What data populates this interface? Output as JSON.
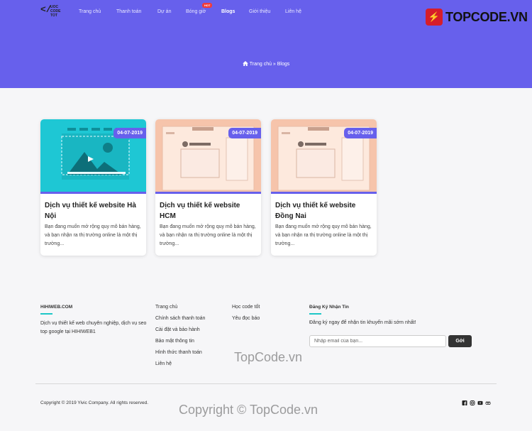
{
  "header": {
    "logo_text_lines": [
      "UOC",
      "CODE",
      "TOT"
    ],
    "nav": [
      {
        "label": "Trang chủ"
      },
      {
        "label": "Thanh toán"
      },
      {
        "label": "Dự án"
      },
      {
        "label": "Bóng giờ",
        "badge": "HOT"
      },
      {
        "label": "Blogs",
        "active": true
      },
      {
        "label": "Giới thiệu"
      },
      {
        "label": "Liên hệ"
      }
    ],
    "brand": "TOPCODE.VN",
    "breadcrumb": "Trang chủ » Blogs"
  },
  "posts": [
    {
      "date": "04-07-2019",
      "title": "Dịch vụ thiết kế website Hà Nội",
      "excerpt": "Bạn đang muốn mở rộng quy mô bán hàng, và bạn nhận ra thị trường online là một thị trường..."
    },
    {
      "date": "04-07-2019",
      "title": "Dịch vụ thiết kế website HCM",
      "excerpt": "Bạn đang muốn mở rộng quy mô bán hàng, và bạn nhận ra thị trường online là một thị trường..."
    },
    {
      "date": "04-07-2019",
      "title": "Dịch vụ thiết kế website Đồng Nai",
      "excerpt": "Bạn đang muốn mở rộng quy mô bán hàng, và bạn nhận ra thị trường online là một thị trường..."
    }
  ],
  "footer": {
    "about_title": "HIHIWEB.COM",
    "about_text": "Dịch vụ thiết kế web chuyên nghiệp, dịch vụ seo top google tại HIHIWEB1",
    "links_col1": [
      "Trang chủ",
      "Chính sách thanh toán",
      "Cài đặt và bảo hành",
      "Bảo mật thông tin",
      "Hình thức thanh toán",
      "Liên hệ"
    ],
    "links_col2": [
      "Học code tốt",
      "Yêu đọc báo"
    ],
    "newsletter_title": "Đăng Ký Nhận Tin",
    "newsletter_text": "Đăng ký ngay để nhận tin khuyến mãi sớm nhất!",
    "email_placeholder": "Nhập email của bạn...",
    "submit_label": "Gởi",
    "copyright": "Copyright © 2019 Yivic Company. All rights reserved.",
    "social_icons": [
      "facebook-icon",
      "instagram-icon",
      "youtube-icon",
      "tripadvisor-icon"
    ]
  },
  "watermarks": [
    "TopCode.vn",
    "Copyright © TopCode.vn"
  ],
  "colors": {
    "primary": "#6760ec",
    "accent": "#1ec7c7",
    "hot": "#ef3b3b"
  }
}
